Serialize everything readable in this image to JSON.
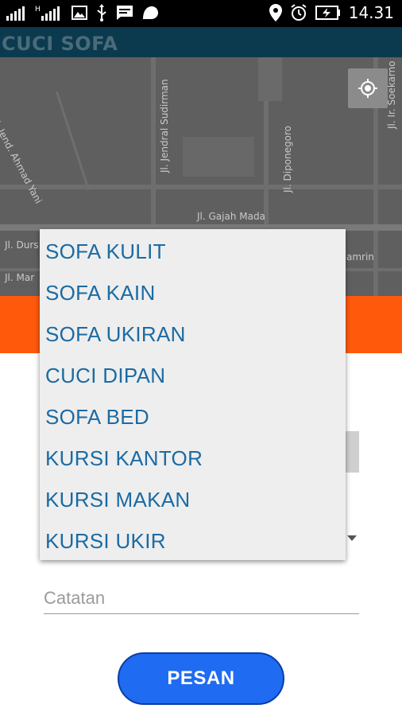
{
  "status_bar": {
    "time": "14.31",
    "icons": [
      "signal-icon",
      "signal-h-icon",
      "image-icon",
      "usb-icon",
      "message-icon",
      "android-icon",
      "location-icon",
      "alarm-icon",
      "battery-charging-icon"
    ]
  },
  "app": {
    "title": "CUCI SOFA"
  },
  "map": {
    "labels": {
      "ahmad_yani": "Jl. Jend. Ahmad Yani",
      "sudirman": "Jl. Jendral Sudirman",
      "diponegoro": "Jl. Diponegoro",
      "gajah_mada": "Jl. Gajah Mada",
      "durs": "Jl. Durs",
      "mar": "Jl. Mar",
      "amrin": "amrin",
      "soekarno": "Jl. Ir. Soekarno"
    }
  },
  "dropdown": {
    "options": [
      "SOFA KULIT",
      "SOFA KAIN",
      "SOFA UKIRAN",
      "CUCI DIPAN",
      "SOFA BED",
      "KURSI KANTOR",
      "KURSI MAKAN",
      "KURSI UKIR"
    ]
  },
  "form": {
    "note_placeholder": "Catatan",
    "order_button": "PESAN"
  },
  "colors": {
    "app_bar": "#0b3a4e",
    "accent_orange": "#ff5a0c",
    "button_blue": "#1f6bf2",
    "dropdown_text": "#1b6ba3"
  }
}
